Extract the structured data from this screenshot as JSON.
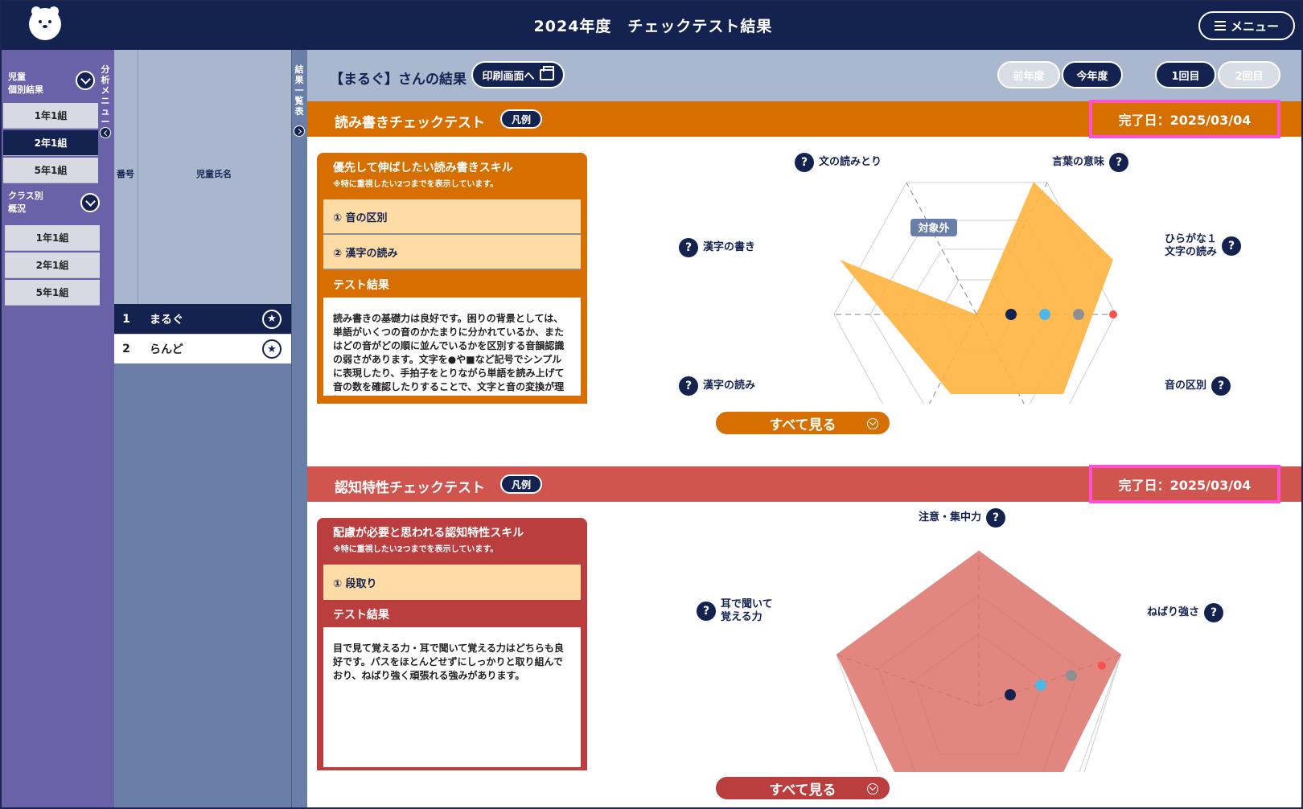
{
  "header": {
    "title": "2024年度　チェックテスト結果",
    "menu_label": "メニュー"
  },
  "nav": {
    "group1_label": "児童\n個別結果",
    "group1_items": [
      {
        "label": "1年1組",
        "active": false
      },
      {
        "label": "2年1組",
        "active": true
      },
      {
        "label": "5年1組",
        "active": false
      }
    ],
    "group2_label": "クラス別\n概況",
    "group2_items": [
      {
        "label": "1年1組"
      },
      {
        "label": "2年1組"
      },
      {
        "label": "5年1組"
      }
    ],
    "vertical_label": "分析メニュー"
  },
  "student_list": {
    "col_no": "番号",
    "col_name": "児童氏名",
    "rows": [
      {
        "no": "1",
        "name": "まるぐ",
        "selected": true
      },
      {
        "no": "2",
        "name": "らんど",
        "selected": false
      }
    ],
    "vertical_label": "結果一覧表"
  },
  "result": {
    "title": "【まるぐ】さんの結果",
    "print_label": "印刷画面へ",
    "year_tabs": [
      {
        "label": "前年度",
        "active": false
      },
      {
        "label": "今年度",
        "active": true
      }
    ],
    "round_tabs": [
      {
        "label": "1回目",
        "active": true
      },
      {
        "label": "2回目",
        "active": false
      }
    ]
  },
  "reading": {
    "title": "読み書きチェックテスト",
    "legend": "凡例",
    "done": "完了日：2025/03/04",
    "color": "#d66f00",
    "card_title": "優先して伸ばしたい読み書きスキル",
    "card_note": "※特に重視したい2つまでを表示しています。",
    "skills": [
      "① 音の区別",
      "② 漢字の読み"
    ],
    "result_head": "テスト結果",
    "result_text": "読み書きの基礎力は良好です。困りの背景としては、単語がいくつの音のかたまりに分かれているか、またはどの音がどの順に並んでいるかを区別する音韻認識の弱さがあります。文字を●や■など記号でシンプルに表現したり、手拍子をとりながら単語を読み上げて音の数を確認したりすることで、文字と音の変換が理解しやすくな",
    "see_all": "すべて見る",
    "na_tag": "対象外",
    "axes": [
      "文の読みとり",
      "言葉の意味",
      "ひらがな１\n文字の読み",
      "音の区別",
      "漢字の読み",
      "漢字の書き"
    ]
  },
  "cognitive": {
    "title": "認知特性チェックテスト",
    "legend": "凡例",
    "done": "完了日：2025/03/04",
    "color": "#d0554f",
    "card_title": "配慮が必要と思われる認知特性スキル",
    "card_note": "※特に重視したい2つまでを表示しています。",
    "skills": [
      "① 段取り"
    ],
    "result_head": "テスト結果",
    "result_text": "目で見て覚える力・耳で聞いて覚える力はどちらも良好です。パスをほとんどせずにしっかりと取り組んでおり、ねばり強く頑張れる強みがあります。",
    "see_all": "すべて見る",
    "axes": [
      "注意・集中力",
      "ねばり強さ",
      "耳で聞いて\n覚える力"
    ]
  }
}
